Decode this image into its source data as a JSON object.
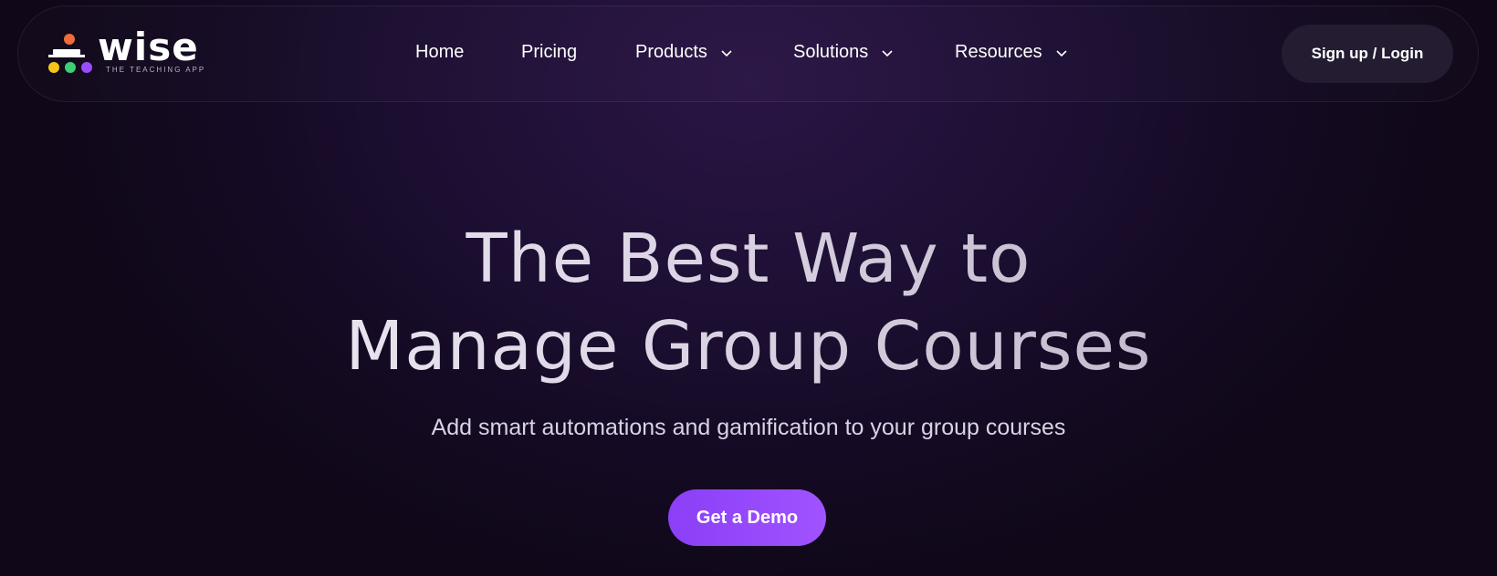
{
  "brand": {
    "name": "wise",
    "tagline": "THE TEACHING APP",
    "dot_colors": [
      "#f26b3a",
      "#f5c518",
      "#3ccf75",
      "#9a4dff"
    ]
  },
  "nav": {
    "items": [
      {
        "label": "Home",
        "has_dropdown": false
      },
      {
        "label": "Pricing",
        "has_dropdown": false
      },
      {
        "label": "Products",
        "has_dropdown": true
      },
      {
        "label": "Solutions",
        "has_dropdown": true
      },
      {
        "label": "Resources",
        "has_dropdown": true
      }
    ],
    "signup_label": "Sign up / Login"
  },
  "hero": {
    "headline_line1": "The Best Way to",
    "headline_line2": "Manage Group Courses",
    "subheadline": "Add smart automations and gamification to your group courses",
    "cta_label": "Get a Demo"
  },
  "colors": {
    "background": "#140a23",
    "accent": "#9a4dff",
    "signup_bg": "#241c30"
  }
}
